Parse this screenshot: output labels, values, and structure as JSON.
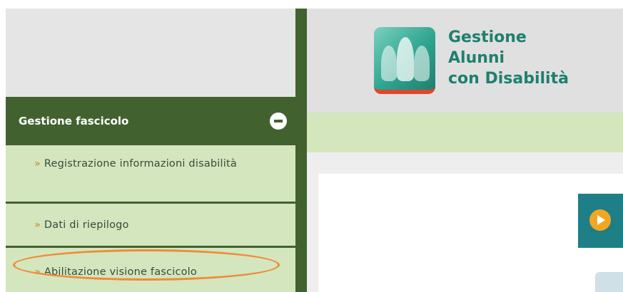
{
  "app": {
    "title_lines": [
      "Gestione",
      "Alunni",
      "con Disabilità"
    ]
  },
  "sidebar": {
    "section_title": "Gestione fascicolo",
    "chevron": "»",
    "items": [
      {
        "label": "Registrazione informazioni disabilità"
      },
      {
        "label": "Dati di riepilogo"
      },
      {
        "label": "Abilitazione visione fascicolo"
      }
    ]
  },
  "icons": {
    "collapse": "minus-circle-icon",
    "play": "play-icon",
    "logo": "people-logo-icon"
  },
  "colors": {
    "sidebar_dark": "#41622f",
    "sidebar_light": "#d4e6be",
    "brand_teal": "#1f7f6e",
    "highlight": "#f08a3a",
    "play_orange": "#f3a622"
  }
}
